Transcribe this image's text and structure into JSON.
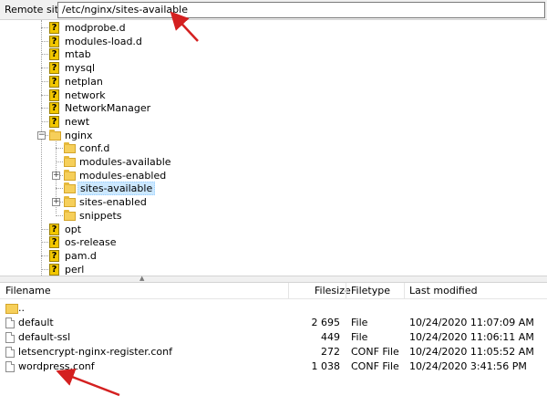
{
  "remote_site": {
    "label": "Remote site:",
    "path": "/etc/nginx/sites-available"
  },
  "tree": {
    "items": [
      {
        "name": "modprobe.d",
        "icon": "question-folder-icon"
      },
      {
        "name": "modules-load.d",
        "icon": "question-folder-icon"
      },
      {
        "name": "mtab",
        "icon": "question-folder-icon"
      },
      {
        "name": "mysql",
        "icon": "question-folder-icon"
      },
      {
        "name": "netplan",
        "icon": "question-folder-icon"
      },
      {
        "name": "network",
        "icon": "question-folder-icon"
      },
      {
        "name": "NetworkManager",
        "icon": "question-folder-icon"
      },
      {
        "name": "newt",
        "icon": "question-folder-icon"
      },
      {
        "name": "nginx",
        "icon": "folder-icon",
        "expanded": true
      },
      {
        "name": "conf.d",
        "icon": "folder-icon",
        "child": true
      },
      {
        "name": "modules-available",
        "icon": "folder-icon",
        "child": true
      },
      {
        "name": "modules-enabled",
        "icon": "folder-icon",
        "child": true,
        "collapsed": true
      },
      {
        "name": "sites-available",
        "icon": "folder-icon",
        "child": true,
        "selected": true
      },
      {
        "name": "sites-enabled",
        "icon": "folder-icon",
        "child": true,
        "collapsed": true
      },
      {
        "name": "snippets",
        "icon": "folder-icon",
        "child": true
      },
      {
        "name": "opt",
        "icon": "question-folder-icon"
      },
      {
        "name": "os-release",
        "icon": "question-folder-icon"
      },
      {
        "name": "pam.d",
        "icon": "question-folder-icon"
      },
      {
        "name": "perl",
        "icon": "question-folder-icon"
      }
    ]
  },
  "file_list": {
    "columns": {
      "filename": "Filename",
      "filesize": "Filesize",
      "filetype": "Filetype",
      "last_modified": "Last modified"
    },
    "parent_dir": "..",
    "rows": [
      {
        "filename": "default",
        "filesize": "2 695",
        "filetype": "File",
        "last_modified": "10/24/2020 11:07:09 AM"
      },
      {
        "filename": "default-ssl",
        "filesize": "449",
        "filetype": "File",
        "last_modified": "10/24/2020 11:06:11 AM"
      },
      {
        "filename": "letsencrypt-nginx-register.conf",
        "filesize": "272",
        "filetype": "CONF File",
        "last_modified": "10/24/2020 11:05:52 AM"
      },
      {
        "filename": "wordpress.conf",
        "filesize": "1 038",
        "filetype": "CONF File",
        "last_modified": "10/24/2020 3:41:56 PM"
      }
    ]
  },
  "colors": {
    "annotation_arrow": "#d42020",
    "selection": "#cce8ff",
    "folder": "#f6cf5a"
  }
}
